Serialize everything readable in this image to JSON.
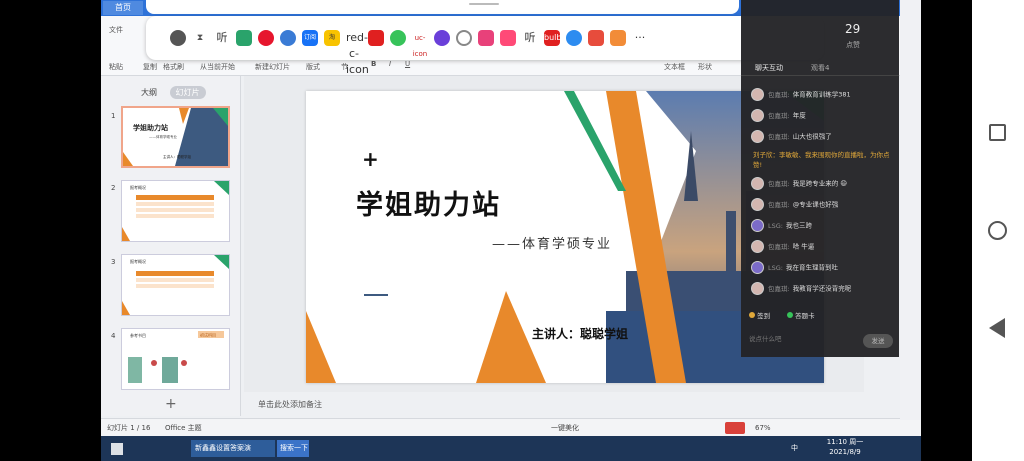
{
  "titlebar": {
    "home_tab": "首页"
  },
  "ribbon": {
    "file_menu": "文件",
    "paste": "粘贴",
    "copy": "复制",
    "format_painter": "格式刷",
    "from_current": "从当前开始",
    "new_slide": "新建幻灯片",
    "layout": "版式",
    "section": "节",
    "textbox": "文本框",
    "shape": "形状",
    "bold": "B",
    "italic": "I",
    "underline": "U"
  },
  "leftpane": {
    "tab_outline": "大纲",
    "tab_slides": "幻灯片",
    "thumbs": [
      "1",
      "2",
      "3",
      "4"
    ],
    "thumb1_title": "学姐助力站",
    "thumb1_sub": "——体育学硕专业",
    "thumb1_speaker": "主讲人：聪聪学姐",
    "thumb2_title": "报考概况",
    "thumb3_title": "报考概况",
    "thumb4_title": "参考书目",
    "thumb4_badge": "初试科目"
  },
  "slide": {
    "plus": "+",
    "title": "学姐助力站",
    "subtitle": "——体育学硕专业",
    "speaker": "主讲人：聪聪学姐"
  },
  "notes": {
    "placeholder": "单击此处添加备注"
  },
  "status": {
    "slide_counter": "幻灯片 1 / 16",
    "theme": "Office 主题",
    "beautify": "一键美化",
    "zoom": "67%"
  },
  "taskbar": {
    "ie_label": "新鑫鑫设置答案演",
    "search_btn": "搜索一下",
    "time": "11:10 周一",
    "date": "2021/8/9",
    "ime": "中"
  },
  "chat": {
    "likes_count": "29",
    "likes_label": "点赞",
    "tab_chat": "聊天互动",
    "tab_viewers": "观看4",
    "messages": [
      {
        "name": "包嘉琪:",
        "text": "体育教育训练学381"
      },
      {
        "name": "包嘉琪:",
        "text": "年度"
      },
      {
        "name": "包嘉琪:",
        "text": "山大也很强了"
      },
      {
        "name": "包嘉琪:",
        "text": "我是跨专业来的 😄"
      },
      {
        "name": "包嘉琪:",
        "text": "@专业课也好强"
      },
      {
        "name": "LSG:",
        "text": "我也三跨"
      },
      {
        "name": "包嘉琪:",
        "text": "哈 牛逼"
      },
      {
        "name": "LSG:",
        "text": "我在育生理背到吐"
      },
      {
        "name": "包嘉琪:",
        "text": "我教育学还没背完呢"
      }
    ],
    "system_msg": "刘子欣：李敏敏、我来围观你的直播啦，为你点赞!",
    "sign_in": "签到",
    "answer_card": "答题卡",
    "input_placeholder": "说点什么吧",
    "send": "发送"
  },
  "iconbar": {
    "icons": [
      "compass-icon",
      "hourglass-icon",
      "听",
      "weibo-icon",
      "blue-circle-icon",
      "知乎",
      "订阅",
      "淘",
      "red-c-icon",
      "play-icon",
      "NA",
      "uc-icon",
      "radar-icon",
      "pink-icon",
      "tiktok-icon",
      "文",
      "听",
      "bulb-icon",
      "mail-icon",
      "heart-icon",
      "···"
    ]
  }
}
